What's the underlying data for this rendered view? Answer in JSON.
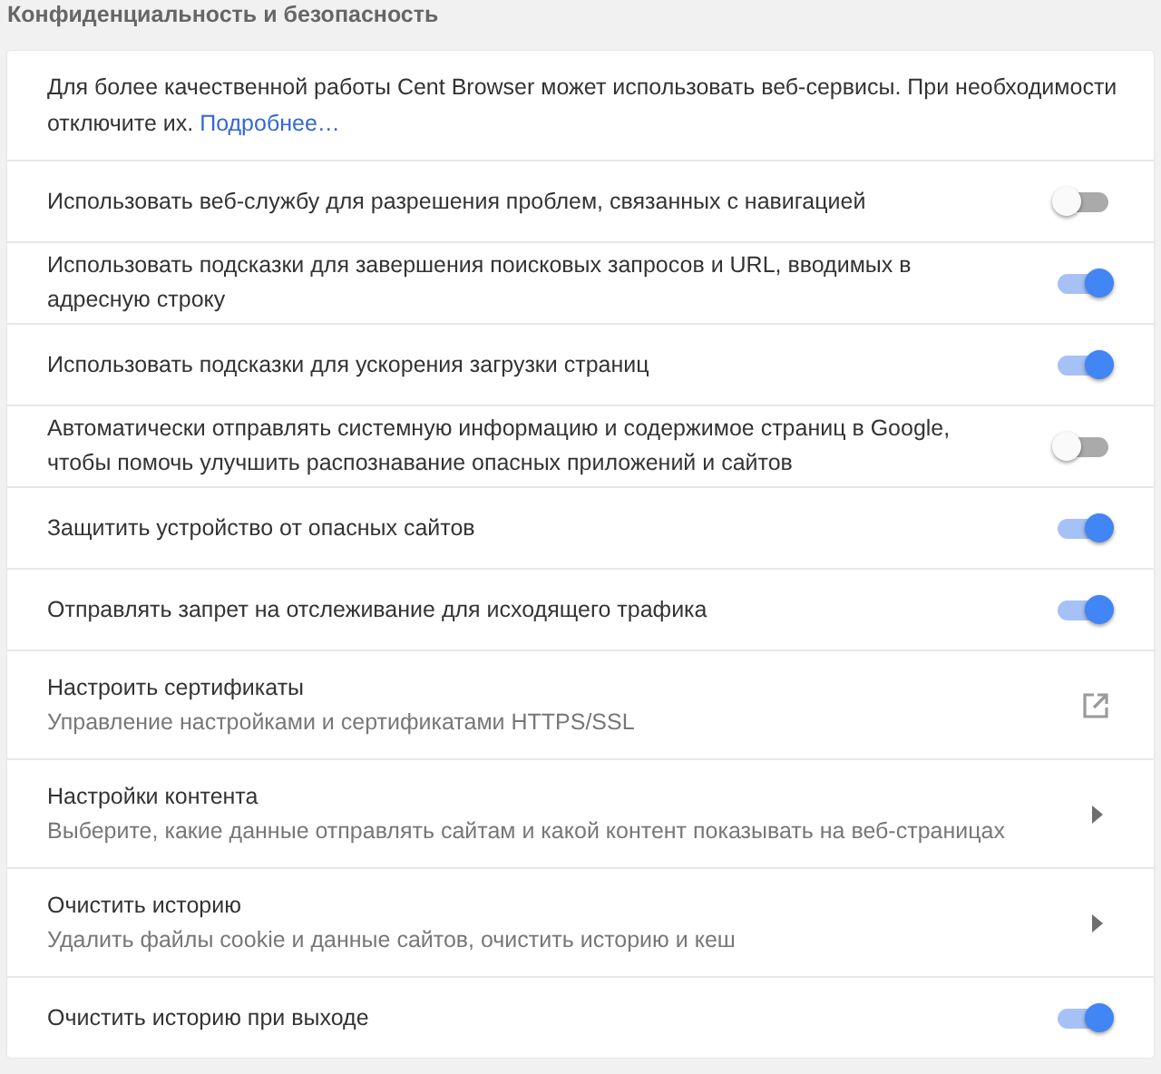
{
  "section_title": "Конфиденциальность и безопасность",
  "intro": {
    "text": "Для более качественной работы Cent Browser может использовать веб-сервисы. При необходимости отключите их.",
    "link": "Подробнее…"
  },
  "rows": [
    {
      "kind": "toggle",
      "label": "Использовать веб-службу для разрешения проблем, связанных с навигацией",
      "on": false
    },
    {
      "kind": "toggle",
      "label": "Использовать подсказки для завершения поисковых запросов и URL, вводимых в адресную строку",
      "on": true
    },
    {
      "kind": "toggle",
      "label": "Использовать подсказки для ускорения загрузки страниц",
      "on": true
    },
    {
      "kind": "toggle",
      "label": "Автоматически отправлять системную информацию и содержимое страниц в Google, чтобы помочь улучшить распознавание опасных приложений и сайтов",
      "on": false
    },
    {
      "kind": "toggle",
      "label": "Защитить устройство от опасных сайтов",
      "on": true
    },
    {
      "kind": "toggle",
      "label": "Отправлять запрет на отслеживание для исходящего трафика",
      "on": true
    },
    {
      "kind": "external",
      "label": "Настроить сертификаты",
      "sublabel": "Управление настройками и сертификатами HTTPS/SSL"
    },
    {
      "kind": "submenu",
      "label": "Настройки контента",
      "sublabel": "Выберите, какие данные отправлять сайтам и какой контент показывать на веб-страницах"
    },
    {
      "kind": "submenu",
      "label": "Очистить историю",
      "sublabel": "Удалить файлы cookie и данные сайтов, очистить историю и кеш"
    },
    {
      "kind": "toggle",
      "label": "Очистить историю при выходе",
      "on": true
    }
  ]
}
